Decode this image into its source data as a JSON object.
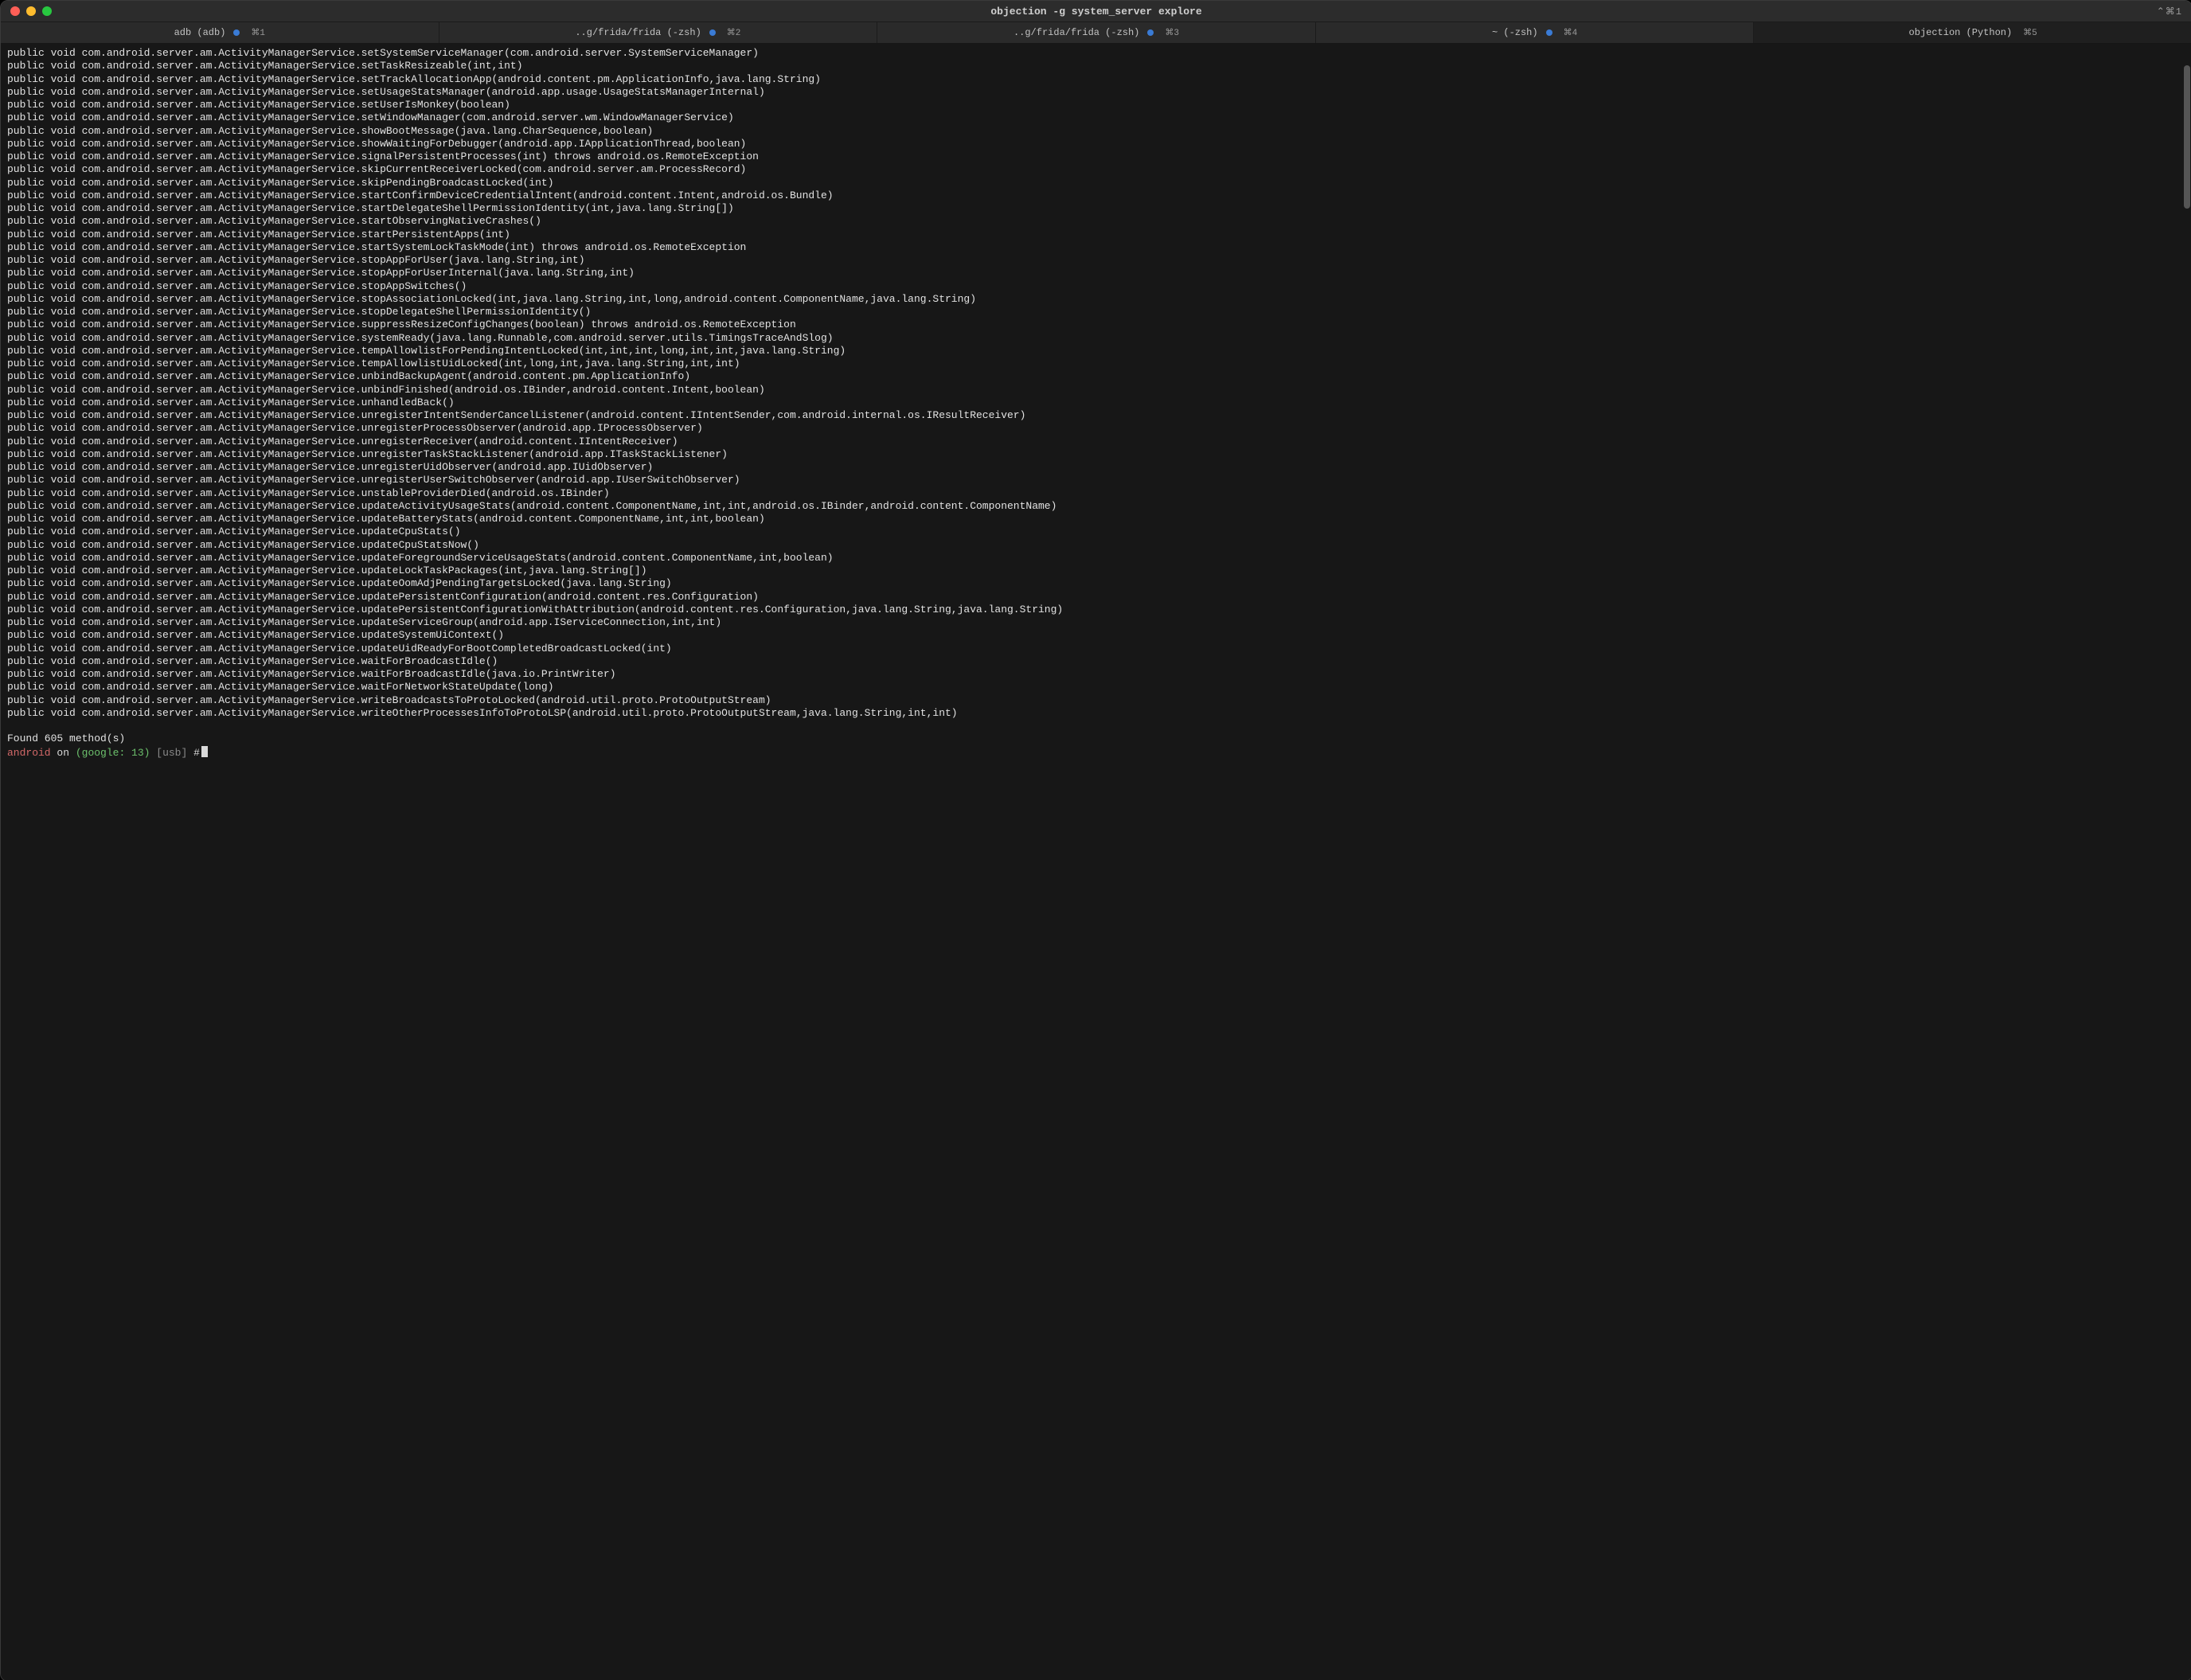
{
  "window": {
    "title": "objection -g system_server explore",
    "shortcut_hint": "⌃⌘1"
  },
  "tabs": [
    {
      "label": "adb (adb)",
      "active": true,
      "shortcut": "⌘1",
      "indicator": true
    },
    {
      "label": "..g/frida/frida (-zsh)",
      "active": true,
      "shortcut": "⌘2",
      "indicator": true
    },
    {
      "label": "..g/frida/frida (-zsh)",
      "active": true,
      "shortcut": "⌘3",
      "indicator": true
    },
    {
      "label": "~ (-zsh)",
      "active": true,
      "shortcut": "⌘4",
      "indicator": true
    },
    {
      "label": "objection (Python)",
      "active": false,
      "shortcut": "⌘5",
      "indicator": false,
      "selected": true
    }
  ],
  "terminal": {
    "lines": [
      "public void com.android.server.am.ActivityManagerService.setSystemServiceManager(com.android.server.SystemServiceManager)",
      "public void com.android.server.am.ActivityManagerService.setTaskResizeable(int,int)",
      "public void com.android.server.am.ActivityManagerService.setTrackAllocationApp(android.content.pm.ApplicationInfo,java.lang.String)",
      "public void com.android.server.am.ActivityManagerService.setUsageStatsManager(android.app.usage.UsageStatsManagerInternal)",
      "public void com.android.server.am.ActivityManagerService.setUserIsMonkey(boolean)",
      "public void com.android.server.am.ActivityManagerService.setWindowManager(com.android.server.wm.WindowManagerService)",
      "public void com.android.server.am.ActivityManagerService.showBootMessage(java.lang.CharSequence,boolean)",
      "public void com.android.server.am.ActivityManagerService.showWaitingForDebugger(android.app.IApplicationThread,boolean)",
      "public void com.android.server.am.ActivityManagerService.signalPersistentProcesses(int) throws android.os.RemoteException",
      "public void com.android.server.am.ActivityManagerService.skipCurrentReceiverLocked(com.android.server.am.ProcessRecord)",
      "public void com.android.server.am.ActivityManagerService.skipPendingBroadcastLocked(int)",
      "public void com.android.server.am.ActivityManagerService.startConfirmDeviceCredentialIntent(android.content.Intent,android.os.Bundle)",
      "public void com.android.server.am.ActivityManagerService.startDelegateShellPermissionIdentity(int,java.lang.String[])",
      "public void com.android.server.am.ActivityManagerService.startObservingNativeCrashes()",
      "public void com.android.server.am.ActivityManagerService.startPersistentApps(int)",
      "public void com.android.server.am.ActivityManagerService.startSystemLockTaskMode(int) throws android.os.RemoteException",
      "public void com.android.server.am.ActivityManagerService.stopAppForUser(java.lang.String,int)",
      "public void com.android.server.am.ActivityManagerService.stopAppForUserInternal(java.lang.String,int)",
      "public void com.android.server.am.ActivityManagerService.stopAppSwitches()",
      "public void com.android.server.am.ActivityManagerService.stopAssociationLocked(int,java.lang.String,int,long,android.content.ComponentName,java.lang.String)",
      "public void com.android.server.am.ActivityManagerService.stopDelegateShellPermissionIdentity()",
      "public void com.android.server.am.ActivityManagerService.suppressResizeConfigChanges(boolean) throws android.os.RemoteException",
      "public void com.android.server.am.ActivityManagerService.systemReady(java.lang.Runnable,com.android.server.utils.TimingsTraceAndSlog)",
      "public void com.android.server.am.ActivityManagerService.tempAllowlistForPendingIntentLocked(int,int,int,long,int,int,java.lang.String)",
      "public void com.android.server.am.ActivityManagerService.tempAllowlistUidLocked(int,long,int,java.lang.String,int,int)",
      "public void com.android.server.am.ActivityManagerService.unbindBackupAgent(android.content.pm.ApplicationInfo)",
      "public void com.android.server.am.ActivityManagerService.unbindFinished(android.os.IBinder,android.content.Intent,boolean)",
      "public void com.android.server.am.ActivityManagerService.unhandledBack()",
      "public void com.android.server.am.ActivityManagerService.unregisterIntentSenderCancelListener(android.content.IIntentSender,com.android.internal.os.IResultReceiver)",
      "public void com.android.server.am.ActivityManagerService.unregisterProcessObserver(android.app.IProcessObserver)",
      "public void com.android.server.am.ActivityManagerService.unregisterReceiver(android.content.IIntentReceiver)",
      "public void com.android.server.am.ActivityManagerService.unregisterTaskStackListener(android.app.ITaskStackListener)",
      "public void com.android.server.am.ActivityManagerService.unregisterUidObserver(android.app.IUidObserver)",
      "public void com.android.server.am.ActivityManagerService.unregisterUserSwitchObserver(android.app.IUserSwitchObserver)",
      "public void com.android.server.am.ActivityManagerService.unstableProviderDied(android.os.IBinder)",
      "public void com.android.server.am.ActivityManagerService.updateActivityUsageStats(android.content.ComponentName,int,int,android.os.IBinder,android.content.ComponentName)",
      "public void com.android.server.am.ActivityManagerService.updateBatteryStats(android.content.ComponentName,int,int,boolean)",
      "public void com.android.server.am.ActivityManagerService.updateCpuStats()",
      "public void com.android.server.am.ActivityManagerService.updateCpuStatsNow()",
      "public void com.android.server.am.ActivityManagerService.updateForegroundServiceUsageStats(android.content.ComponentName,int,boolean)",
      "public void com.android.server.am.ActivityManagerService.updateLockTaskPackages(int,java.lang.String[])",
      "public void com.android.server.am.ActivityManagerService.updateOomAdjPendingTargetsLocked(java.lang.String)",
      "public void com.android.server.am.ActivityManagerService.updatePersistentConfiguration(android.content.res.Configuration)",
      "public void com.android.server.am.ActivityManagerService.updatePersistentConfigurationWithAttribution(android.content.res.Configuration,java.lang.String,java.lang.String)",
      "public void com.android.server.am.ActivityManagerService.updateServiceGroup(android.app.IServiceConnection,int,int)",
      "public void com.android.server.am.ActivityManagerService.updateSystemUiContext()",
      "public void com.android.server.am.ActivityManagerService.updateUidReadyForBootCompletedBroadcastLocked(int)",
      "public void com.android.server.am.ActivityManagerService.waitForBroadcastIdle()",
      "public void com.android.server.am.ActivityManagerService.waitForBroadcastIdle(java.io.PrintWriter)",
      "public void com.android.server.am.ActivityManagerService.waitForNetworkStateUpdate(long)",
      "public void com.android.server.am.ActivityManagerService.writeBroadcastsToProtoLocked(android.util.proto.ProtoOutputStream)",
      "public void com.android.server.am.ActivityManagerService.writeOtherProcessesInfoToProtoLSP(android.util.proto.ProtoOutputStream,java.lang.String,int,int)"
    ],
    "summary": "Found 605 method(s)",
    "prompt": {
      "p1": "android",
      "p2": "on",
      "p3": "(google: 13)",
      "p4": "[usb]",
      "p5": "#"
    }
  }
}
